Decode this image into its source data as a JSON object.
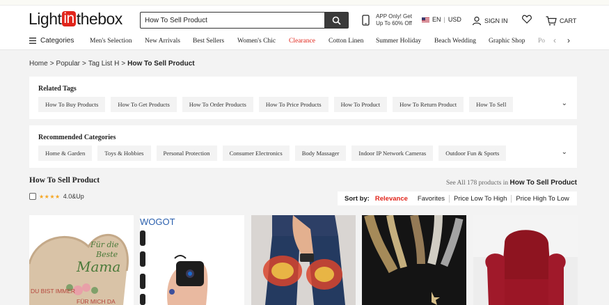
{
  "header": {
    "logo": {
      "pre": "Light",
      "box": "in",
      "post": "thebox"
    },
    "search_value": "How To Sell Product",
    "app_promo": "APP Only! Get Up To 60% Off",
    "lang": "EN",
    "currency": "USD",
    "signin": "SIGN IN",
    "cart": "CART"
  },
  "nav": {
    "categories_label": "Categories",
    "links": [
      "Men's Selection",
      "New Arrivals",
      "Best Sellers",
      "Women's Chic",
      "Clearance",
      "Cotton Linen",
      "Summer Holiday",
      "Beach Wedding",
      "Graphic Shop",
      "Po"
    ]
  },
  "breadcrumb": {
    "items": [
      "Home",
      "Popular",
      "Tag List H"
    ],
    "current": "How To Sell Product"
  },
  "related_tags": {
    "title": "Related Tags",
    "items": [
      "How To Buy Products",
      "How To Get Products",
      "How To Order Products",
      "How To Price Products",
      "How To Product",
      "How To Return Product",
      "How To Sell"
    ]
  },
  "recommended": {
    "title": "Recommended Categories",
    "items": [
      "Home & Garden",
      "Toys & Hobbies",
      "Personal Protection",
      "Consumer Electronics",
      "Body Massager",
      "Indoor IP Network Cameras",
      "Outdoor Fun & Sports"
    ]
  },
  "results": {
    "title": "How To Sell Product",
    "rating_label": "4.0&Up",
    "see_all_prefix": "See All 178 products in",
    "see_all_term": "How To Sell Product"
  },
  "sort": {
    "label": "Sort by:",
    "options": [
      "Relevance",
      "Favorites",
      "Price Low To High",
      "Price High To Low"
    ]
  },
  "products": {
    "p1": {
      "line1": "Für die",
      "line2": "Beste",
      "line3": "Mama",
      "line4": "DU BIST IMMER",
      "line5": "FÜR MICH DA"
    },
    "p2": {
      "brand": "WOGOT"
    }
  },
  "colors": {
    "accent": "#e1251b",
    "star": "#f5a623"
  }
}
